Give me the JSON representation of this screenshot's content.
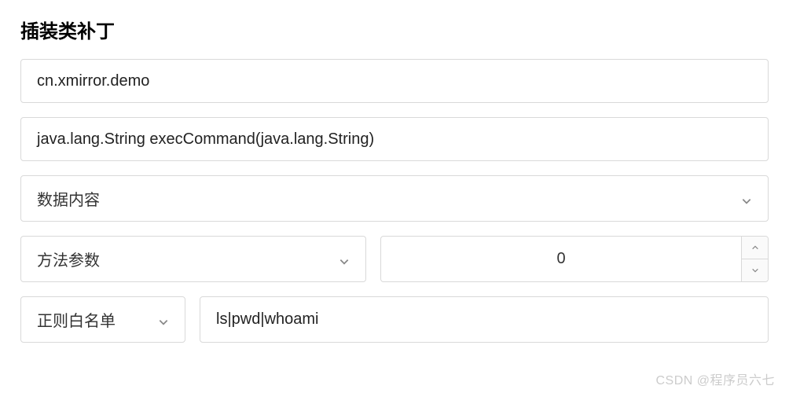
{
  "title": "插装类补丁",
  "fields": {
    "classInput": "cn.xmirror.demo",
    "methodInput": "java.lang.String execCommand(java.lang.String)",
    "dataContentSelect": "数据内容",
    "methodParamSelect": "方法参数",
    "numberValue": "0",
    "regexWhitelistSelect": "正则白名单",
    "regexWhitelistInput": "ls|pwd|whoami"
  },
  "watermark": "CSDN @程序员六七"
}
